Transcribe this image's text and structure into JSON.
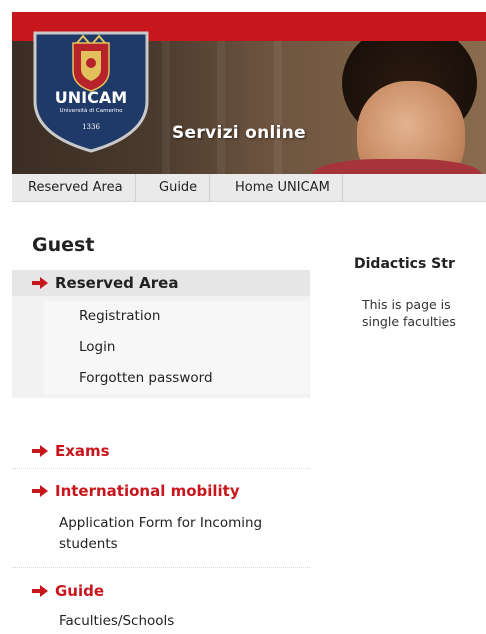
{
  "header": {
    "logo": {
      "name": "UNICAM",
      "subtitle": "Università di Camerino",
      "year": "1336"
    },
    "service_title": "Servizi online"
  },
  "nav": {
    "items": [
      {
        "label": "Reserved Area"
      },
      {
        "label": "Guide"
      },
      {
        "label": "Home UNICAM"
      }
    ]
  },
  "sidebar": {
    "title": "Guest",
    "reserved": {
      "label": "Reserved Area",
      "links": [
        {
          "label": "Registration"
        },
        {
          "label": "Login"
        },
        {
          "label": "Forgotten password"
        }
      ]
    },
    "exams": {
      "label": "Exams"
    },
    "mobility": {
      "label": "International mobility",
      "link_line1": "Application Form for Incoming",
      "link_line2": "students"
    },
    "guide": {
      "label": "Guide",
      "link": "Faculties/Schools"
    }
  },
  "main": {
    "title": "Didactics Str",
    "text_line1": "This is page is",
    "text_line2": "single faculties"
  },
  "colors": {
    "accent_red": "#c8161d",
    "shield_blue": "#1f3a68",
    "nav_bg": "#eaeaea"
  }
}
